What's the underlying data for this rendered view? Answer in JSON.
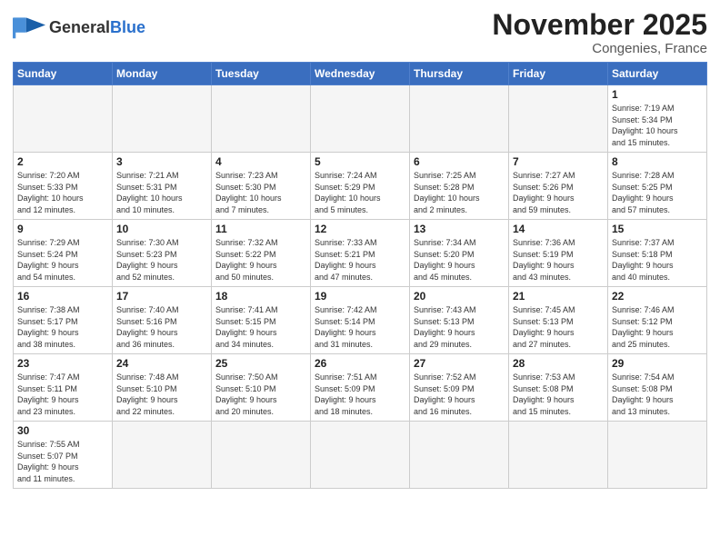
{
  "logo": {
    "general": "General",
    "blue": "Blue"
  },
  "title": "November 2025",
  "location": "Congenies, France",
  "days_of_week": [
    "Sunday",
    "Monday",
    "Tuesday",
    "Wednesday",
    "Thursday",
    "Friday",
    "Saturday"
  ],
  "weeks": [
    [
      {
        "day": null,
        "info": null
      },
      {
        "day": null,
        "info": null
      },
      {
        "day": null,
        "info": null
      },
      {
        "day": null,
        "info": null
      },
      {
        "day": null,
        "info": null
      },
      {
        "day": null,
        "info": null
      },
      {
        "day": "1",
        "info": "Sunrise: 7:19 AM\nSunset: 5:34 PM\nDaylight: 10 hours\nand 15 minutes."
      }
    ],
    [
      {
        "day": "2",
        "info": "Sunrise: 7:20 AM\nSunset: 5:33 PM\nDaylight: 10 hours\nand 12 minutes."
      },
      {
        "day": "3",
        "info": "Sunrise: 7:21 AM\nSunset: 5:31 PM\nDaylight: 10 hours\nand 10 minutes."
      },
      {
        "day": "4",
        "info": "Sunrise: 7:23 AM\nSunset: 5:30 PM\nDaylight: 10 hours\nand 7 minutes."
      },
      {
        "day": "5",
        "info": "Sunrise: 7:24 AM\nSunset: 5:29 PM\nDaylight: 10 hours\nand 5 minutes."
      },
      {
        "day": "6",
        "info": "Sunrise: 7:25 AM\nSunset: 5:28 PM\nDaylight: 10 hours\nand 2 minutes."
      },
      {
        "day": "7",
        "info": "Sunrise: 7:27 AM\nSunset: 5:26 PM\nDaylight: 9 hours\nand 59 minutes."
      },
      {
        "day": "8",
        "info": "Sunrise: 7:28 AM\nSunset: 5:25 PM\nDaylight: 9 hours\nand 57 minutes."
      }
    ],
    [
      {
        "day": "9",
        "info": "Sunrise: 7:29 AM\nSunset: 5:24 PM\nDaylight: 9 hours\nand 54 minutes."
      },
      {
        "day": "10",
        "info": "Sunrise: 7:30 AM\nSunset: 5:23 PM\nDaylight: 9 hours\nand 52 minutes."
      },
      {
        "day": "11",
        "info": "Sunrise: 7:32 AM\nSunset: 5:22 PM\nDaylight: 9 hours\nand 50 minutes."
      },
      {
        "day": "12",
        "info": "Sunrise: 7:33 AM\nSunset: 5:21 PM\nDaylight: 9 hours\nand 47 minutes."
      },
      {
        "day": "13",
        "info": "Sunrise: 7:34 AM\nSunset: 5:20 PM\nDaylight: 9 hours\nand 45 minutes."
      },
      {
        "day": "14",
        "info": "Sunrise: 7:36 AM\nSunset: 5:19 PM\nDaylight: 9 hours\nand 43 minutes."
      },
      {
        "day": "15",
        "info": "Sunrise: 7:37 AM\nSunset: 5:18 PM\nDaylight: 9 hours\nand 40 minutes."
      }
    ],
    [
      {
        "day": "16",
        "info": "Sunrise: 7:38 AM\nSunset: 5:17 PM\nDaylight: 9 hours\nand 38 minutes."
      },
      {
        "day": "17",
        "info": "Sunrise: 7:40 AM\nSunset: 5:16 PM\nDaylight: 9 hours\nand 36 minutes."
      },
      {
        "day": "18",
        "info": "Sunrise: 7:41 AM\nSunset: 5:15 PM\nDaylight: 9 hours\nand 34 minutes."
      },
      {
        "day": "19",
        "info": "Sunrise: 7:42 AM\nSunset: 5:14 PM\nDaylight: 9 hours\nand 31 minutes."
      },
      {
        "day": "20",
        "info": "Sunrise: 7:43 AM\nSunset: 5:13 PM\nDaylight: 9 hours\nand 29 minutes."
      },
      {
        "day": "21",
        "info": "Sunrise: 7:45 AM\nSunset: 5:13 PM\nDaylight: 9 hours\nand 27 minutes."
      },
      {
        "day": "22",
        "info": "Sunrise: 7:46 AM\nSunset: 5:12 PM\nDaylight: 9 hours\nand 25 minutes."
      }
    ],
    [
      {
        "day": "23",
        "info": "Sunrise: 7:47 AM\nSunset: 5:11 PM\nDaylight: 9 hours\nand 23 minutes."
      },
      {
        "day": "24",
        "info": "Sunrise: 7:48 AM\nSunset: 5:10 PM\nDaylight: 9 hours\nand 22 minutes."
      },
      {
        "day": "25",
        "info": "Sunrise: 7:50 AM\nSunset: 5:10 PM\nDaylight: 9 hours\nand 20 minutes."
      },
      {
        "day": "26",
        "info": "Sunrise: 7:51 AM\nSunset: 5:09 PM\nDaylight: 9 hours\nand 18 minutes."
      },
      {
        "day": "27",
        "info": "Sunrise: 7:52 AM\nSunset: 5:09 PM\nDaylight: 9 hours\nand 16 minutes."
      },
      {
        "day": "28",
        "info": "Sunrise: 7:53 AM\nSunset: 5:08 PM\nDaylight: 9 hours\nand 15 minutes."
      },
      {
        "day": "29",
        "info": "Sunrise: 7:54 AM\nSunset: 5:08 PM\nDaylight: 9 hours\nand 13 minutes."
      }
    ],
    [
      {
        "day": "30",
        "info": "Sunrise: 7:55 AM\nSunset: 5:07 PM\nDaylight: 9 hours\nand 11 minutes."
      },
      {
        "day": null,
        "info": null
      },
      {
        "day": null,
        "info": null
      },
      {
        "day": null,
        "info": null
      },
      {
        "day": null,
        "info": null
      },
      {
        "day": null,
        "info": null
      },
      {
        "day": null,
        "info": null
      }
    ]
  ]
}
